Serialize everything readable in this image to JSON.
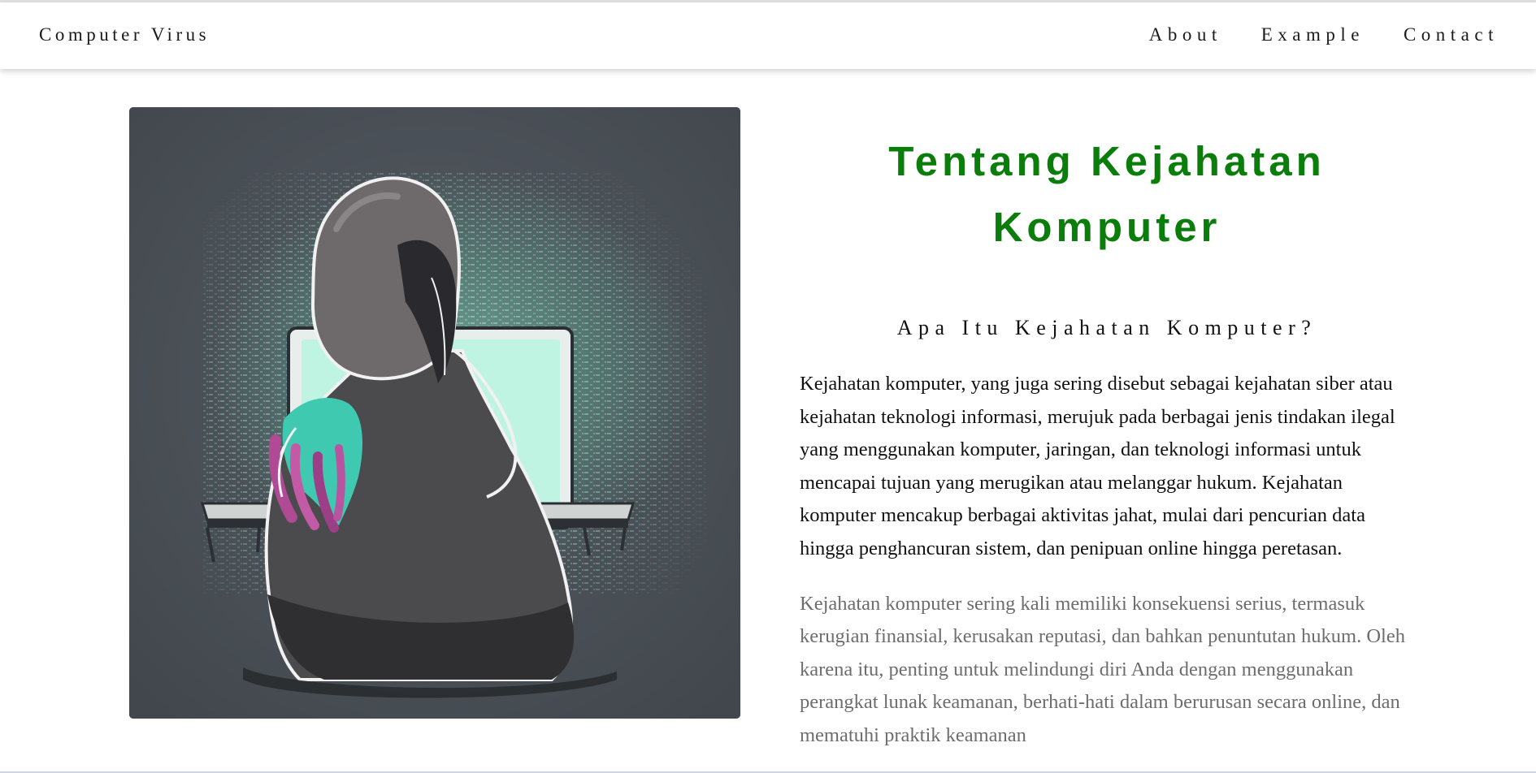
{
  "nav": {
    "brand": "Computer Virus",
    "links": [
      "About",
      "Example",
      "Contact"
    ]
  },
  "hero": {
    "image_alt": "Hooded hacker sitting in front of a laptop with green code in the background"
  },
  "main": {
    "title": "Tentang Kejahatan Komputer",
    "subtitle": "Apa Itu Kejahatan Komputer?",
    "paragraphs": [
      "Kejahatan komputer, yang juga sering disebut sebagai kejahatan siber atau kejahatan teknologi informasi, merujuk pada berbagai jenis tindakan ilegal yang menggunakan komputer, jaringan, dan teknologi informasi untuk mencapai tujuan yang merugikan atau melanggar hukum. Kejahatan komputer mencakup berbagai aktivitas jahat, mulai dari pencurian data hingga penghancuran sistem, dan penipuan online hingga peretasan.",
      "Kejahatan komputer sering kali memiliki konsekuensi serius, termasuk kerugian finansial, kerusakan reputasi, dan bahkan penuntutan hukum. Oleh karena itu, penting untuk melindungi diri Anda dengan menggunakan perangkat lunak keamanan, berhati-hati dalam berurusan secara online, dan mematuhi praktik keamanan"
    ]
  },
  "colors": {
    "title": "#0a7d0a",
    "secondary_text": "#6d6d6d",
    "image_background": "#4a4f57"
  }
}
